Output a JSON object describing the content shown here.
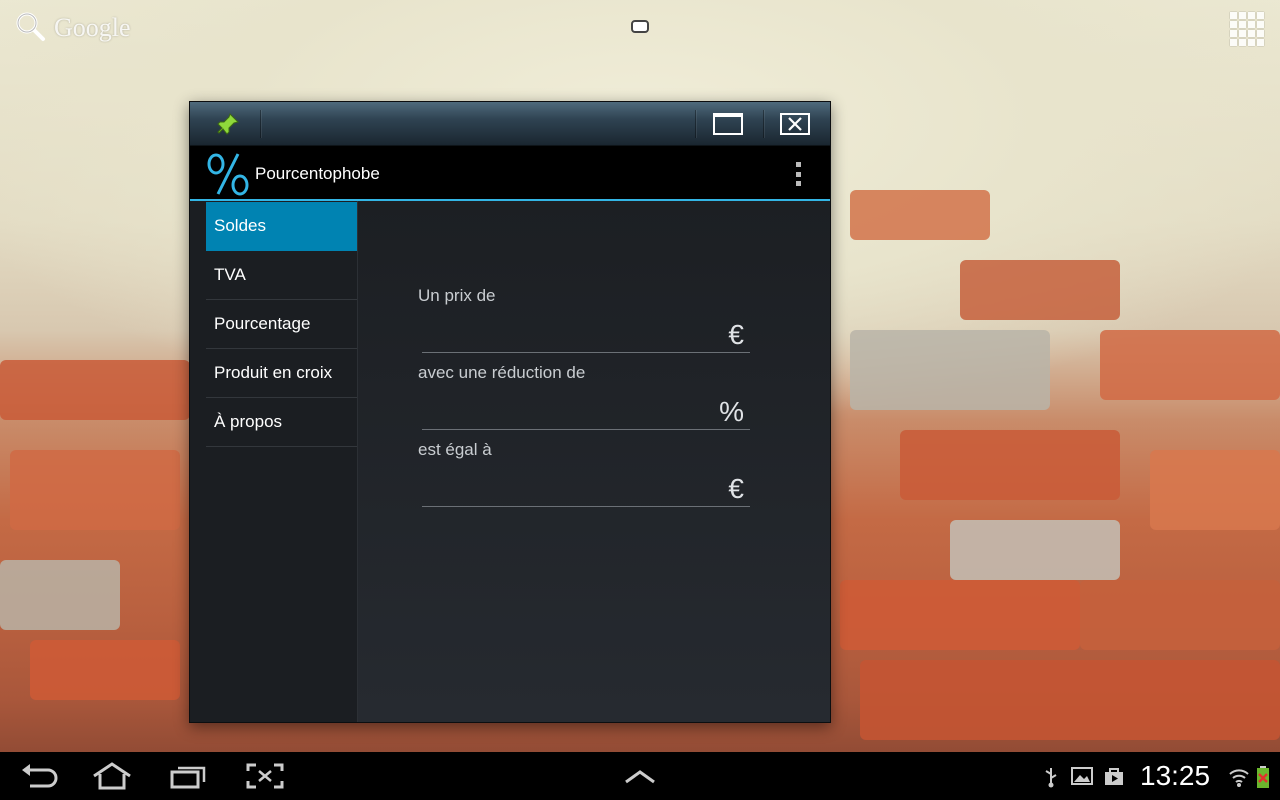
{
  "desktop": {
    "search_label": "Google",
    "icons": {
      "search": "search-icon",
      "apps": "apps-grid-icon"
    }
  },
  "window": {
    "titlebar": {
      "icons": [
        "pin-icon",
        "maximize-icon",
        "close-icon"
      ]
    },
    "app": {
      "title": "Pourcentophobe",
      "logo": "percent-logo-icon",
      "accent_color": "#33b5e5"
    },
    "sidebar": {
      "items": [
        {
          "label": "Soldes",
          "active": true
        },
        {
          "label": "TVA",
          "active": false
        },
        {
          "label": "Pourcentage",
          "active": false
        },
        {
          "label": "Produit en croix",
          "active": false
        },
        {
          "label": "À propos",
          "active": false
        }
      ],
      "active_color": "#0083b2"
    },
    "form": {
      "price_label": "Un prix de",
      "price_value": "",
      "price_unit": "€",
      "discount_label": "avec une réduction de",
      "discount_value": "",
      "discount_unit": "%",
      "result_label": "est égal à",
      "result_value": "",
      "result_unit": "€"
    }
  },
  "systembar": {
    "nav_icons": [
      "back-icon",
      "home-icon",
      "recent-apps-icon",
      "screenshot-icon",
      "up-arrow-icon"
    ],
    "status_icons": [
      "usb-icon",
      "gallery-icon",
      "store-icon",
      "wifi-icon",
      "battery-icon"
    ],
    "clock": "13:25"
  }
}
